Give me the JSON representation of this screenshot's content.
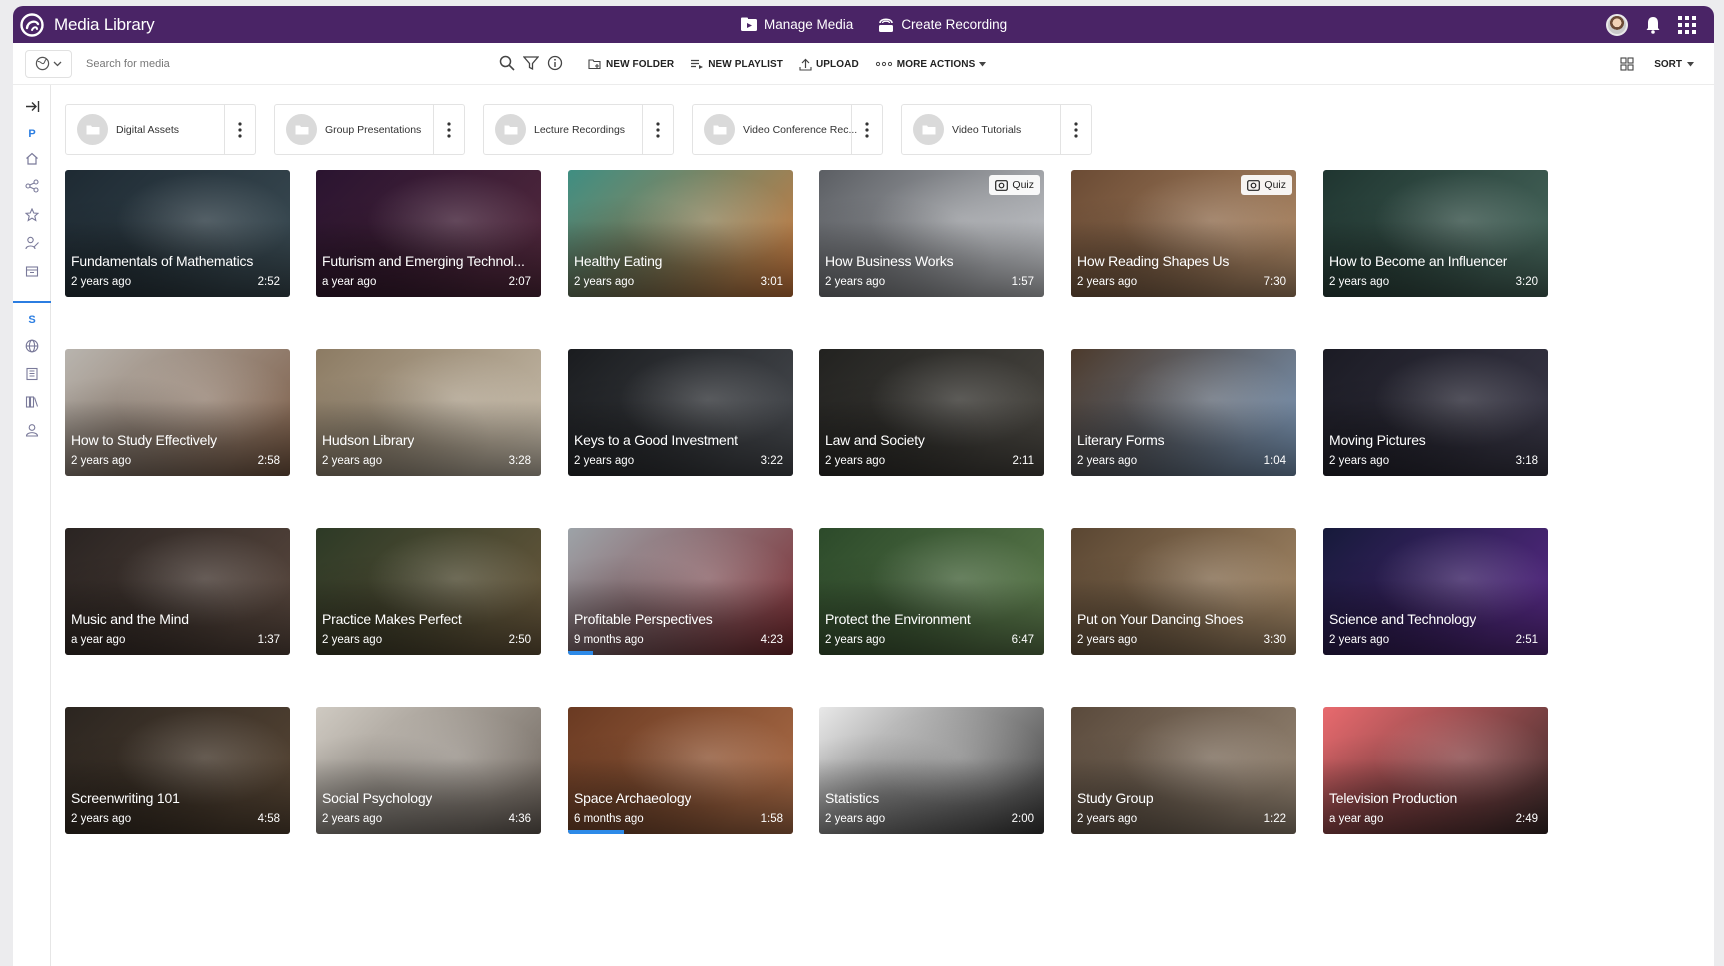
{
  "app": {
    "title": "Media Library"
  },
  "topnav": {
    "manage_media": "Manage Media",
    "create_recording": "Create Recording"
  },
  "toolbar": {
    "search_placeholder": "Search for media",
    "new_folder": "NEW FOLDER",
    "new_playlist": "NEW PLAYLIST",
    "upload": "UPLOAD",
    "more_actions": "MORE ACTIONS",
    "sort": "SORT"
  },
  "rail": {
    "personal_letter": "P",
    "shared_letter": "S"
  },
  "folders": [
    {
      "name": "Digital Assets"
    },
    {
      "name": "Group Presentations"
    },
    {
      "name": "Lecture Recordings"
    },
    {
      "name": "Video Conference Rec..."
    },
    {
      "name": "Video Tutorials"
    }
  ],
  "quiz_label": "Quiz",
  "media": [
    {
      "title": "Fundamentals of Mathematics",
      "age": "2 years ago",
      "duration": "2:52",
      "colors": [
        "#1e2a33",
        "#3c4d55"
      ]
    },
    {
      "title": "Futurism and Emerging Technol...",
      "age": "a year ago",
      "duration": "2:07",
      "colors": [
        "#2a1430",
        "#552a3e"
      ]
    },
    {
      "title": "Healthy Eating",
      "age": "2 years ago",
      "duration": "3:01",
      "colors": [
        "#3f8e82",
        "#d07a3d"
      ]
    },
    {
      "title": "How Business Works",
      "age": "2 years ago",
      "duration": "1:57",
      "quiz": true,
      "colors": [
        "#5b5e63",
        "#c9cbcf"
      ]
    },
    {
      "title": "How Reading Shapes Us",
      "age": "2 years ago",
      "duration": "7:30",
      "quiz": true,
      "colors": [
        "#6b4b34",
        "#b38e6b"
      ]
    },
    {
      "title": "How to Become an Influencer",
      "age": "2 years ago",
      "duration": "3:20",
      "colors": [
        "#1f3530",
        "#4a6a5f"
      ]
    },
    {
      "title": "How to Study Effectively",
      "age": "2 years ago",
      "duration": "2:58",
      "colors": [
        "#b8b4ae",
        "#7a5a44"
      ]
    },
    {
      "title": "Hudson Library",
      "age": "2 years ago",
      "duration": "3:28",
      "colors": [
        "#8c7b63",
        "#c9bfae"
      ]
    },
    {
      "title": "Keys to a Good Investment",
      "age": "2 years ago",
      "duration": "3:22",
      "colors": [
        "#1a1c1f",
        "#4a4d52"
      ]
    },
    {
      "title": "Law and Society",
      "age": "2 years ago",
      "duration": "2:11",
      "colors": [
        "#222220",
        "#4d4a44"
      ]
    },
    {
      "title": "Literary Forms",
      "age": "2 years ago",
      "duration": "1:04",
      "colors": [
        "#4c3a2c",
        "#7d9bbd"
      ]
    },
    {
      "title": "Moving Pictures",
      "age": "2 years ago",
      "duration": "3:18",
      "colors": [
        "#1b1b24",
        "#3c3a4a"
      ]
    },
    {
      "title": "Music and the Mind",
      "age": "a year ago",
      "duration": "1:37",
      "colors": [
        "#2a2422",
        "#5c4a40"
      ]
    },
    {
      "title": "Practice Makes Perfect",
      "age": "2 years ago",
      "duration": "2:50",
      "colors": [
        "#2d3a26",
        "#6c5a3e"
      ]
    },
    {
      "title": "Profitable Perspectives",
      "age": "9 months ago",
      "duration": "4:23",
      "progress": 0.11,
      "colors": [
        "#9da3a8",
        "#7a2a30"
      ]
    },
    {
      "title": "Protect the Environment",
      "age": "2 years ago",
      "duration": "6:47",
      "colors": [
        "#2c4a2a",
        "#5f7d4e"
      ]
    },
    {
      "title": "Put on Your Dancing Shoes",
      "age": "2 years ago",
      "duration": "3:30",
      "colors": [
        "#5a4632",
        "#a88c6a"
      ]
    },
    {
      "title": "Science and Technology",
      "age": "2 years ago",
      "duration": "2:51",
      "colors": [
        "#161a3a",
        "#5c2a8a"
      ]
    },
    {
      "title": "Screenwriting 101",
      "age": "2 years ago",
      "duration": "4:58",
      "colors": [
        "#2b2520",
        "#5a4836"
      ]
    },
    {
      "title": "Social Psychology",
      "age": "2 years ago",
      "duration": "4:36",
      "colors": [
        "#cfcac2",
        "#6b625a"
      ]
    },
    {
      "title": "Space Archaeology",
      "age": "6 months ago",
      "duration": "1:58",
      "progress": 0.25,
      "colors": [
        "#6a3a22",
        "#b0704a"
      ]
    },
    {
      "title": "Statistics",
      "age": "2 years ago",
      "duration": "2:00",
      "colors": [
        "#e8e8e8",
        "#3a3a3a"
      ]
    },
    {
      "title": "Study Group",
      "age": "2 years ago",
      "duration": "1:22",
      "colors": [
        "#5a4a3c",
        "#9a8a78"
      ]
    },
    {
      "title": "Television Production",
      "age": "a year ago",
      "duration": "2:49",
      "colors": [
        "#e86a6e",
        "#3a2a2a"
      ]
    }
  ]
}
